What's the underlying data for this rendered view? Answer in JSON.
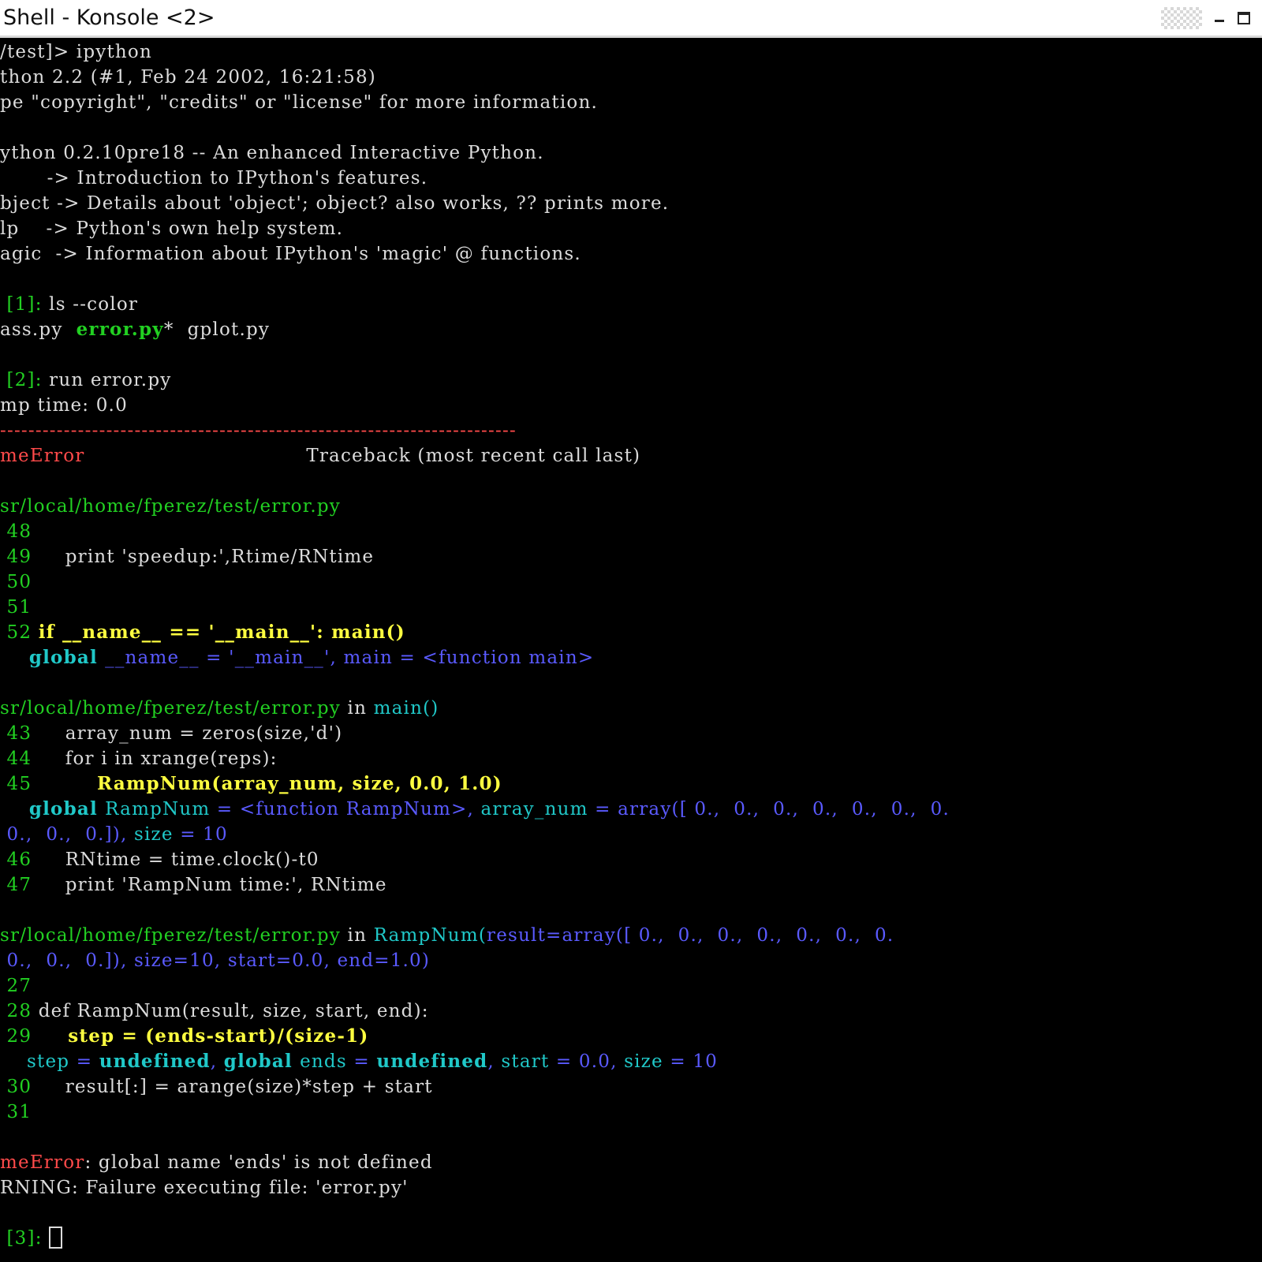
{
  "window": {
    "title": "Shell - Konsole <2>"
  },
  "colors": {
    "background": "#000000",
    "default": "#dcdcdc",
    "green": "#22d022",
    "yellow": "#ffff40",
    "cyan": "#20c8c8",
    "blue": "#5a5aff",
    "red": "#ff4a4a"
  },
  "lines": [
    [
      {
        "t": "/test]> ipython"
      }
    ],
    [
      {
        "t": "thon 2.2 (#1, Feb 24 2002, 16:21:58)"
      }
    ],
    [
      {
        "t": "pe \"copyright\", \"credits\" or \"license\" for more information."
      }
    ],
    [],
    [
      {
        "t": "ython 0.2.10pre18 -- An enhanced Interactive Python."
      }
    ],
    [
      {
        "t": "       -> Introduction to IPython's features."
      }
    ],
    [
      {
        "t": "bject -> Details about 'object'; object? also works, ?? prints more."
      }
    ],
    [
      {
        "t": "lp    -> Python's own help system."
      }
    ],
    [
      {
        "t": "agic  -> Information about IPython's 'magic' @ functions."
      }
    ],
    [],
    [
      {
        "t": " [1]: ",
        "c": "green"
      },
      {
        "t": "ls --color"
      }
    ],
    [
      {
        "t": "ass.py  "
      },
      {
        "t": "error.py",
        "c": "green",
        "b": true
      },
      {
        "t": "*  gplot.py"
      }
    ],
    [],
    [
      {
        "t": " [2]: ",
        "c": "green"
      },
      {
        "t": "run error.py"
      }
    ],
    [
      {
        "t": "mp time: 0.0"
      }
    ],
    [
      {
        "t": "-------------------------------------------------------------------------",
        "c": "red"
      }
    ],
    [
      {
        "t": "meError",
        "c": "red"
      },
      {
        "t": "                                 Traceback (most recent call last)"
      }
    ],
    [],
    [
      {
        "t": "sr/local/home/fperez/test/error.py",
        "c": "green"
      }
    ],
    [
      {
        "t": " 48",
        "c": "green"
      }
    ],
    [
      {
        "t": " 49",
        "c": "green"
      },
      {
        "t": "     print 'speedup:',Rtime/RNtime"
      }
    ],
    [
      {
        "t": " 50",
        "c": "green"
      }
    ],
    [
      {
        "t": " 51",
        "c": "green"
      }
    ],
    [
      {
        "t": " 52 ",
        "c": "green"
      },
      {
        "t": "if __name__ == '__main__': main()",
        "c": "yellow",
        "b": true
      }
    ],
    [
      {
        "t": "    global ",
        "c": "cyan",
        "b": true
      },
      {
        "t": "__name__ = '__main__', main = <function main>",
        "c": "blue"
      }
    ],
    [],
    [
      {
        "t": "sr/local/home/fperez/test/error.py",
        "c": "green"
      },
      {
        "t": " in "
      },
      {
        "t": "main()",
        "c": "cyan"
      }
    ],
    [
      {
        "t": " 43",
        "c": "green"
      },
      {
        "t": "     array_num = zeros(size,'d')"
      }
    ],
    [
      {
        "t": " 44",
        "c": "green"
      },
      {
        "t": "     for i in xrange(reps):"
      }
    ],
    [
      {
        "t": " 45",
        "c": "green"
      },
      {
        "t": "         RampNum(array_num, size, 0.0, 1.0)",
        "c": "yellow",
        "b": true
      }
    ],
    [
      {
        "t": "    global ",
        "c": "cyan",
        "b": true
      },
      {
        "t": "RampNum",
        "c": "cyan"
      },
      {
        "t": " = <function RampNum>, ",
        "c": "blue"
      },
      {
        "t": "array_num",
        "c": "cyan"
      },
      {
        "t": " = array([ 0.,  0.,  0.,  0.,  0.,  0.,  0.",
        "c": "blue"
      }
    ],
    [
      {
        "t": " 0.,  0.,  0.]), ",
        "c": "blue"
      },
      {
        "t": "size",
        "c": "cyan"
      },
      {
        "t": " = 10",
        "c": "blue"
      }
    ],
    [
      {
        "t": " 46",
        "c": "green"
      },
      {
        "t": "     RNtime = time.clock()-t0"
      }
    ],
    [
      {
        "t": " 47",
        "c": "green"
      },
      {
        "t": "     print 'RampNum time:', RNtime"
      }
    ],
    [],
    [
      {
        "t": "sr/local/home/fperez/test/error.py",
        "c": "green"
      },
      {
        "t": " in "
      },
      {
        "t": "RampNum(",
        "c": "cyan"
      },
      {
        "t": "result=array([ 0.,  0.,  0.,  0.,  0.,  0.,  0.",
        "c": "blue"
      }
    ],
    [
      {
        "t": " 0.,  0.,  0.]), size=10, start=0.0, end=1.0)",
        "c": "blue"
      }
    ],
    [
      {
        "t": " 27",
        "c": "green"
      }
    ],
    [
      {
        "t": " 28 ",
        "c": "green"
      },
      {
        "t": "def RampNum(result, size, start, end):"
      }
    ],
    [
      {
        "t": " 29",
        "c": "green"
      },
      {
        "t": "     step = (ends-start)/(size-1)",
        "c": "yellow",
        "b": true
      }
    ],
    [
      {
        "t": "    step",
        "c": "cyan"
      },
      {
        "t": " = ",
        "c": "blue"
      },
      {
        "t": "undefined",
        "c": "cyan",
        "b": true
      },
      {
        "t": ", ",
        "c": "blue"
      },
      {
        "t": "global ",
        "c": "cyan",
        "b": true
      },
      {
        "t": "ends",
        "c": "cyan"
      },
      {
        "t": " = ",
        "c": "blue"
      },
      {
        "t": "undefined",
        "c": "cyan",
        "b": true
      },
      {
        "t": ", ",
        "c": "blue"
      },
      {
        "t": "start",
        "c": "cyan"
      },
      {
        "t": " = 0.0, ",
        "c": "blue"
      },
      {
        "t": "size",
        "c": "cyan"
      },
      {
        "t": " = 10",
        "c": "blue"
      }
    ],
    [
      {
        "t": " 30",
        "c": "green"
      },
      {
        "t": "     result[:] = arange(size)*step + start"
      }
    ],
    [
      {
        "t": " 31",
        "c": "green"
      }
    ],
    [],
    [
      {
        "t": "meError",
        "c": "red"
      },
      {
        "t": ": global name 'ends' is not defined"
      }
    ],
    [
      {
        "t": "RNING: Failure executing file: 'error.py'"
      }
    ],
    [],
    [
      {
        "t": " [3]: ",
        "c": "green"
      }
    ]
  ]
}
